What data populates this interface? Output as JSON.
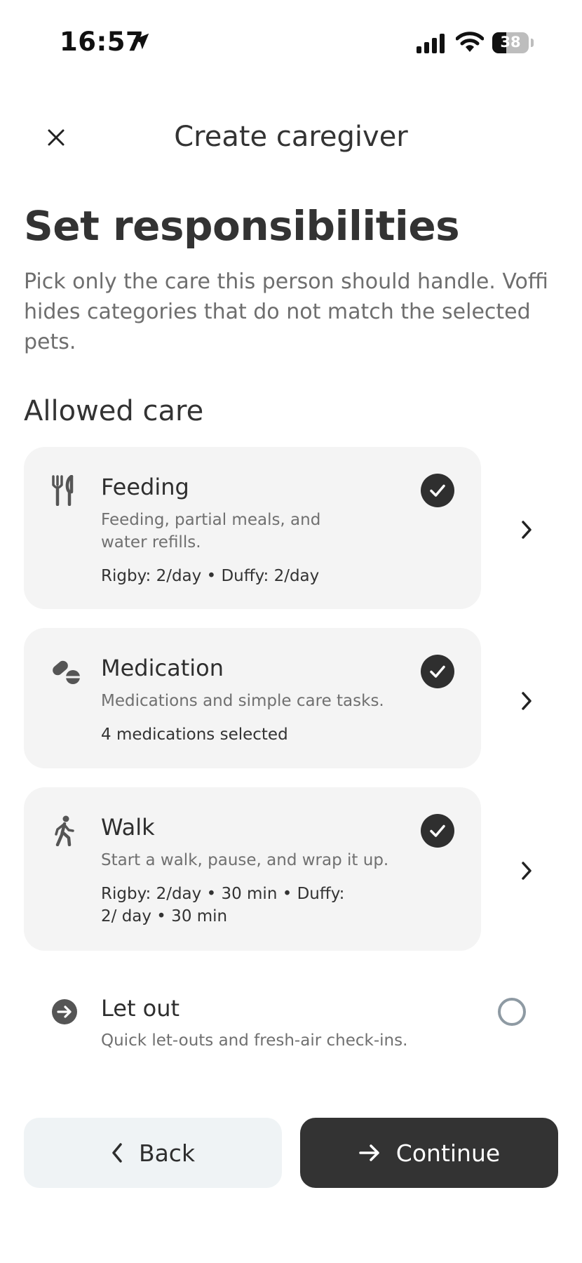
{
  "status_bar": {
    "time": "16:57",
    "battery": "38",
    "battery_level": 0.38
  },
  "header": {
    "title": "Create caregiver"
  },
  "page": {
    "title": "Set responsibilities",
    "subtitle": "Pick only the care this person should handle. Voffi hides categories that do not match the selected pets."
  },
  "section": {
    "title": "Allowed care"
  },
  "care_items": [
    {
      "icon": "utensils-icon",
      "title": "Feeding",
      "description": "Feeding, partial meals, and water refills.",
      "detail": "Rigby: 2/day • Duffy: 2/day",
      "checked": true
    },
    {
      "icon": "pills-icon",
      "title": "Medication",
      "description": "Medications and simple care tasks.",
      "detail": "4 medications selected",
      "checked": true
    },
    {
      "icon": "walking-person-icon",
      "title": "Walk",
      "description": "Start a walk, pause, and wrap it up.",
      "detail": "Rigby: 2/day • 30 min • Duffy: 2/ day • 30 min",
      "checked": true
    }
  ],
  "let_out": {
    "icon": "arrow-circle-icon",
    "title": "Let out",
    "description": "Quick let-outs and fresh-air check-ins.",
    "checked": false
  },
  "footer": {
    "back_label": "Back",
    "continue_label": "Continue"
  },
  "colors": {
    "card_bg": "#f4f4f4",
    "primary": "#333333",
    "secondary_button_bg": "#eff3f5",
    "muted_text": "#707070"
  }
}
